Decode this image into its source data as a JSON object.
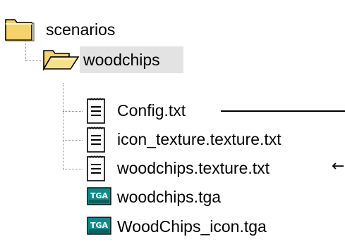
{
  "tree": {
    "root": {
      "label": "scenarios",
      "icon": "folder-closed-icon"
    },
    "child_folder": {
      "label": "woodchips",
      "icon": "folder-open-icon",
      "selected": true
    },
    "files": [
      {
        "label": "Config.txt",
        "icon": "text-file-icon"
      },
      {
        "label": "icon_texture.texture.txt",
        "icon": "text-file-icon"
      },
      {
        "label": "woodchips.texture.txt",
        "icon": "text-file-icon"
      },
      {
        "label": "woodchips.tga",
        "icon": "tga-image-icon",
        "badge": "TGA"
      },
      {
        "label": "WoodChips_icon.tga",
        "icon": "tga-image-icon",
        "badge": "TGA"
      }
    ]
  },
  "annotations": {
    "line_label": "",
    "arrow_glyph": "←"
  },
  "colors": {
    "folder_yellow": "#f3d36a",
    "selection_gray": "#e3e3e3",
    "tga_teal": "#0e8a8a"
  }
}
